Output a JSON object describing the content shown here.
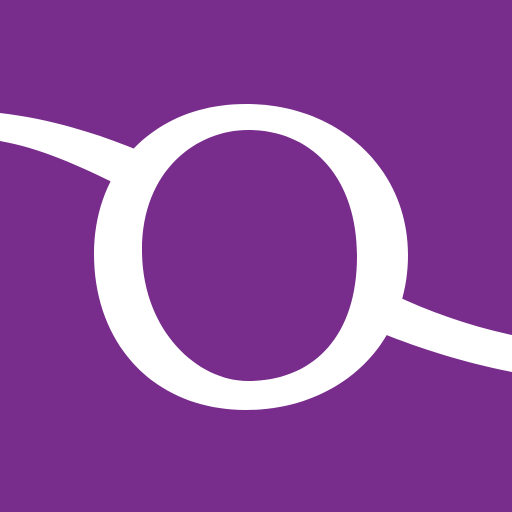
{
  "app_icon": {
    "icon_name": "q-orbit-logo-icon",
    "background_color": "#782c8b",
    "foreground_color": "#ffffff"
  }
}
